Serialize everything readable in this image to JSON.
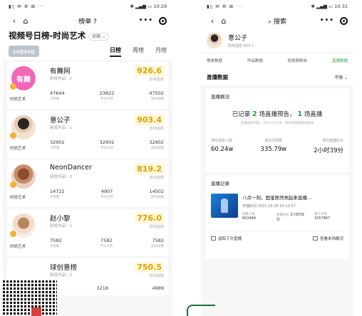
{
  "left": {
    "status": {
      "time": "10:29",
      "icons": "▮▯ ✉ ⚙ ⊞ ···",
      "right_icons": "✱ ▂▄▆ ▭"
    },
    "nav": {
      "title": "榜单",
      "help": "?",
      "capsule": "•••"
    },
    "board": {
      "title": "视频号日榜-时尚艺术",
      "category": "初级 ⌄",
      "date": "10月03日"
    },
    "tabs": [
      {
        "label": "日榜"
      },
      {
        "label": "周榜"
      },
      {
        "label": "月榜"
      }
    ],
    "entries": [
      {
        "name": "有舞网",
        "avatar_text": "有舞",
        "sub": "新增作品：2",
        "category": "时尚艺术",
        "score": "926.6",
        "score_label": "影响指数",
        "stats": [
          {
            "v": "47644",
            "l": "点赞数"
          },
          {
            "v": "23822",
            "l": "平均点赞"
          },
          {
            "v": "47502",
            "l": "影响指数"
          }
        ]
      },
      {
        "name": "意公子",
        "avatar_text": "",
        "sub": "新增作品：1",
        "category": "时尚艺术",
        "score": "903.4",
        "score_label": "影响指数",
        "stats": [
          {
            "v": "32902",
            "l": "点赞数"
          },
          {
            "v": "32902",
            "l": "平均点赞"
          },
          {
            "v": "32902",
            "l": "影响指数"
          }
        ]
      },
      {
        "name": "NeonDancer",
        "avatar_text": "",
        "sub": "新增作品：3",
        "category": "时尚艺术",
        "score": "819.2",
        "score_label": "影响指数",
        "stats": [
          {
            "v": "14722",
            "l": "点赞数"
          },
          {
            "v": "4907",
            "l": "平均点赞"
          },
          {
            "v": "14502",
            "l": "影响指数"
          }
        ]
      },
      {
        "name": "赵小黎",
        "avatar_text": "",
        "sub": "新增作品：1",
        "category": "时尚艺术",
        "score": "776.0",
        "score_label": "影响指数",
        "stats": [
          {
            "v": "7582",
            "l": "点赞数"
          },
          {
            "v": "7582",
            "l": "平均点赞"
          },
          {
            "v": "7582",
            "l": "影响指数"
          }
        ]
      },
      {
        "name": "球创意榜",
        "avatar_text": "",
        "sub": "新增作品：2",
        "category": "",
        "score": "750.5",
        "score_label": "影响指数",
        "stats": [
          {
            "v": "6",
            "l": ""
          },
          {
            "v": "3218",
            "l": ""
          },
          {
            "v": "4989",
            "l": ""
          }
        ]
      }
    ]
  },
  "right": {
    "status": {
      "time": "10:31",
      "icons": "▮▯ ✉ ⚙ ⊞ ···",
      "right_icons": "✱ ▂▄▆ ▭"
    },
    "nav": {
      "search": "搜索",
      "capsule": "•••"
    },
    "profile": {
      "name": "意公子",
      "meta": "影响指数  839.7"
    },
    "tabs": [
      {
        "label": "榜单数据"
      },
      {
        "label": "作品数据"
      },
      {
        "label": "短视频粉丝"
      },
      {
        "label": "直播数据"
      }
    ],
    "live_head": {
      "title": "直播数据",
      "filter": "不限 ⌄"
    },
    "overview": {
      "title": "直播概况",
      "summary_pre": "已记录",
      "count_a": "2",
      "summary_mid": "场直播预告，",
      "count_b": "1",
      "summary_post": "场直播",
      "sub": "直播追踪时段：2021-10-28，更早的数据暂未收录",
      "stats": [
        {
          "l": "场均观看人数",
          "v": "60.24w"
        },
        {
          "l": "场均点赞数",
          "v": "335.79w"
        },
        {
          "l": "场均直播时长",
          "v": "2小时39分"
        }
      ]
    },
    "record": {
      "title": "直播记录",
      "item_title": "八点一刻，国宝居然亮起来直播…",
      "item_time": "开播时间  2021-10-28 20:10:57",
      "m1_label": "观看人数",
      "m1_value": "602464",
      "m2_label": "直播时长",
      "m2_value": "2小时39分",
      "m3_label": "累计点赞",
      "m3_value": "3357867",
      "action_a": "追踪下次直播",
      "action_b": "查看本场概况"
    }
  }
}
